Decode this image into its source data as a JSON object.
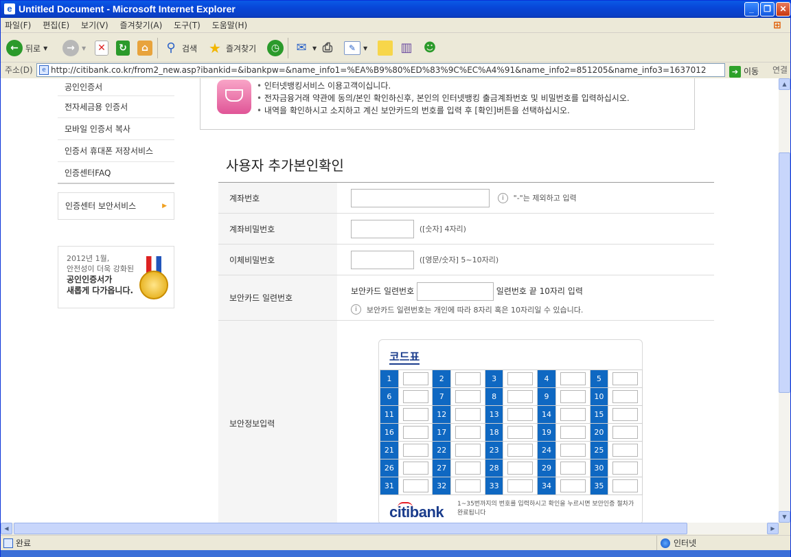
{
  "window": {
    "title": "Untitled Document - Microsoft Internet Explorer"
  },
  "menubar": [
    "파일(F)",
    "편집(E)",
    "보기(V)",
    "즐겨찾기(A)",
    "도구(T)",
    "도움말(H)"
  ],
  "toolbar": {
    "back_label": "뒤로",
    "search_label": "검색",
    "favorites_label": "즐겨찾기"
  },
  "address": {
    "label": "주소(D)",
    "url": "http://citibank.co.kr/from2_new.asp?ibankid=&ibankpw=&name_info1=%EA%B9%80%ED%83%9C%EC%A4%91&name_info2=851205&name_info3=1637012",
    "go_label": "이동",
    "links_label": "연결"
  },
  "sidebar": {
    "items": [
      "공인인증서",
      "전자세금용 인증서",
      "모바일 인증서 복사",
      "인증서 휴대폰 저장서비스",
      "인증센터FAQ"
    ],
    "security_service": "인증센터 보안서비스",
    "banner": {
      "line1": "2012년 1월,",
      "line2": "안전성이 더욱 강화된",
      "line3": "공인인증서가",
      "line4": "새롭게 다가옵니다."
    }
  },
  "notice": [
    "인터넷뱅킹서비스 이용고객이십니다.",
    "전자금융거래 약관에 동의/본인 확인하신후, 본인의 인터넷뱅킹 출금계좌번호 및 비밀번호를 입력하십시오.",
    "내역을 확인하시고 소지하고 계신 보안카드의 번호를 입력 후 [확인]버튼을 선택하십시오."
  ],
  "form": {
    "title": "사용자 추가본인확인",
    "account_label": "계좌번호",
    "account_hint": "\"-\"는 제외하고 입력",
    "account_pw_label": "계좌비밀번호",
    "account_pw_hint": "([숫자] 4자리)",
    "transfer_pw_label": "이체비밀번호",
    "transfer_pw_hint": "([영문/숫자] 5~10자리)",
    "card_serial_label": "보안카드 일련번호",
    "card_serial_prefix": "보안카드 일련번호",
    "card_serial_suffix": "일련번호 끝 10자리 입력",
    "card_serial_note": "보안카드 일련번호는 개인에 따라 8자리 혹은 10자리일 수 있습니다.",
    "security_input_label": "보안정보입력"
  },
  "codecard": {
    "title": "코드표",
    "rows": [
      [
        "1",
        "2",
        "3",
        "4",
        "5"
      ],
      [
        "6",
        "7",
        "8",
        "9",
        "10"
      ],
      [
        "11",
        "12",
        "13",
        "14",
        "15"
      ],
      [
        "16",
        "17",
        "18",
        "19",
        "20"
      ],
      [
        "21",
        "22",
        "23",
        "24",
        "25"
      ],
      [
        "26",
        "27",
        "28",
        "29",
        "30"
      ],
      [
        "31",
        "32",
        "33",
        "34",
        "35"
      ]
    ],
    "logo": "citibank",
    "note": "1~35번까지의 번호를 입력하시고 확인을 누르시면 보안인증 절차가 완료됩니다"
  },
  "status": {
    "text": "완료",
    "zone": "인터넷"
  },
  "colors": {
    "titlebar": "#0a3fc4",
    "code_num_bg": "#0f68c2",
    "citi_blue": "#1a3c8c",
    "citi_red": "#e51b24"
  }
}
